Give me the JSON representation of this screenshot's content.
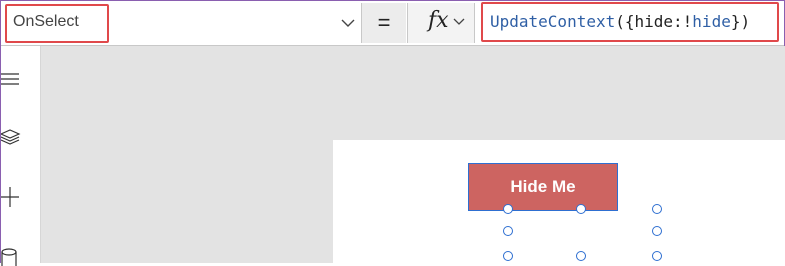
{
  "formula_bar": {
    "property": "OnSelect",
    "equals": "=",
    "fx_label": "fx",
    "formula": {
      "fn": "UpdateContext",
      "open": "({",
      "key": "hide:!",
      "ident": "hide",
      "close": "})"
    }
  },
  "left_rail": {
    "icons": [
      "tree-view-icon",
      "layers-icon",
      "insert-plus-icon",
      "data-cylinder-icon"
    ]
  },
  "canvas": {
    "selected_control": {
      "label": "Hide Me",
      "fill_color": "#cd6461",
      "selection_color": "#2e6fd1"
    }
  },
  "colors": {
    "highlight_border": "#e0494b",
    "formula_function": "#2f5fa5",
    "frame_border": "#8a5fb0"
  }
}
